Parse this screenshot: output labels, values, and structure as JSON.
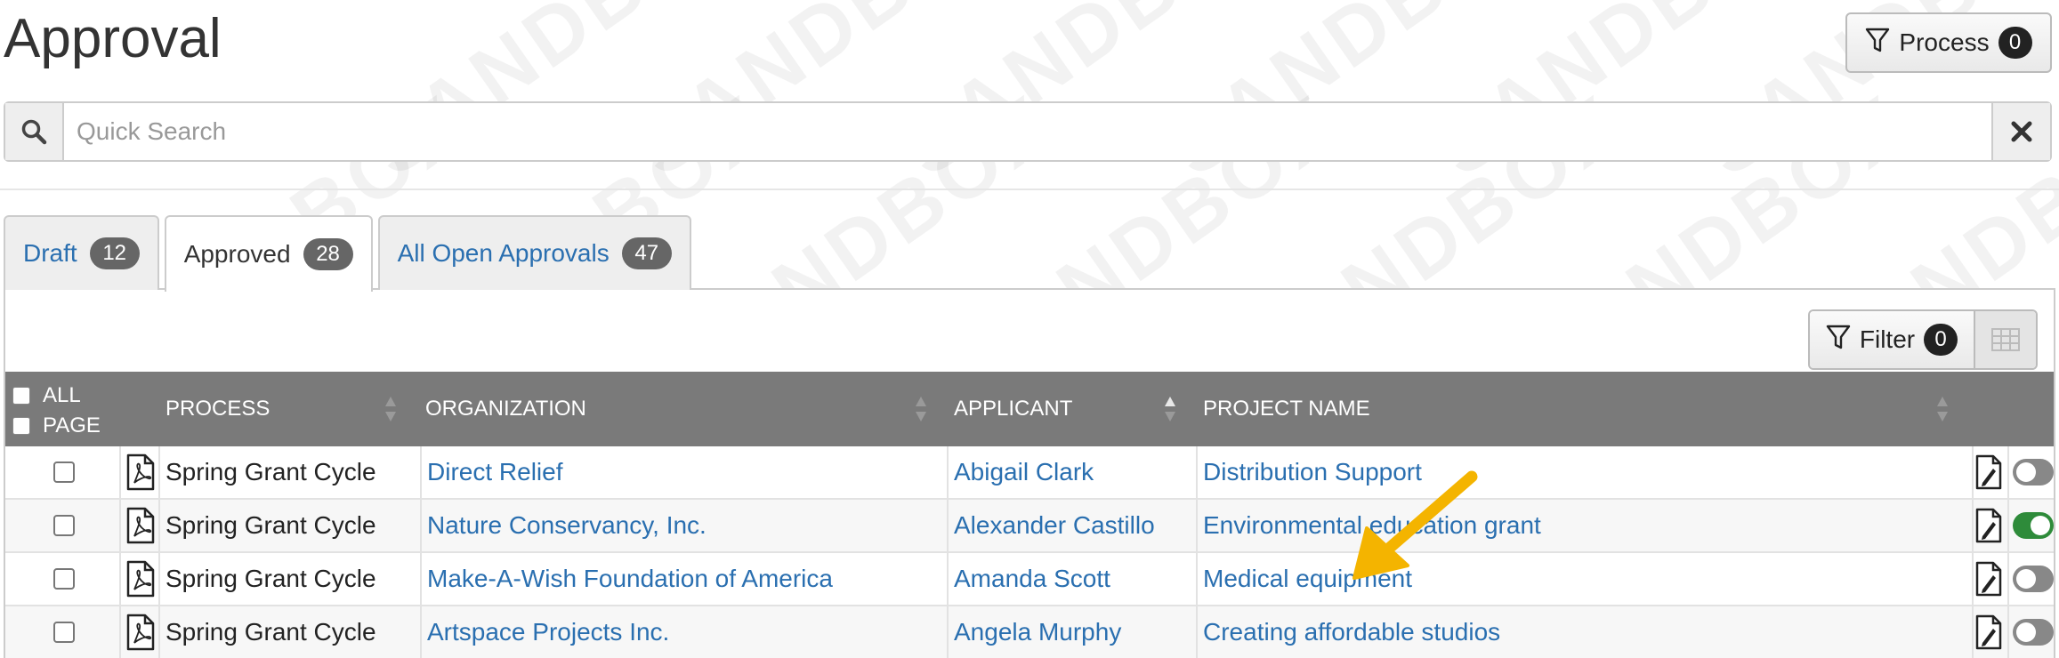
{
  "page": {
    "title": "Approval",
    "watermark": "SANDBOX"
  },
  "header": {
    "process_label": "Process",
    "process_count": "0"
  },
  "search": {
    "placeholder": "Quick Search"
  },
  "tabs": [
    {
      "label": "Draft",
      "count": "12",
      "active": false
    },
    {
      "label": "Approved",
      "count": "28",
      "active": true
    },
    {
      "label": "All Open Approvals",
      "count": "47",
      "active": false
    }
  ],
  "toolbar": {
    "filter_label": "Filter",
    "filter_count": "0"
  },
  "table": {
    "select_all_label": "ALL",
    "select_page_label": "PAGE",
    "columns": [
      "PROCESS",
      "ORGANIZATION",
      "APPLICANT",
      "PROJECT NAME"
    ],
    "rows": [
      {
        "process": "Spring Grant Cycle",
        "organization": "Direct Relief",
        "applicant": "Abigail Clark",
        "project": "Distribution Support",
        "toggle_on": false
      },
      {
        "process": "Spring Grant Cycle",
        "organization": "Nature Conservancy, Inc.",
        "applicant": "Alexander Castillo",
        "project": "Environmental education grant",
        "toggle_on": true
      },
      {
        "process": "Spring Grant Cycle",
        "organization": "Make-A-Wish Foundation of America",
        "applicant": "Amanda Scott",
        "project": "Medical equipment",
        "toggle_on": false
      },
      {
        "process": "Spring Grant Cycle",
        "organization": "Artspace Projects Inc.",
        "applicant": "Angela Murphy",
        "project": "Creating affordable studios",
        "toggle_on": false
      }
    ]
  },
  "colors": {
    "link": "#2a6fb0",
    "header_bg": "#7a7a7a",
    "toggle_on": "#2e8b3a",
    "arrow": "#f4b400"
  },
  "icons": {
    "process": "filter-icon",
    "search": "search-icon",
    "clear": "close-icon",
    "filter": "filter-icon",
    "grid": "grid-icon",
    "pdf": "pdf-file-icon",
    "edit": "edit-document-icon",
    "annotation": "arrow-annotation"
  }
}
